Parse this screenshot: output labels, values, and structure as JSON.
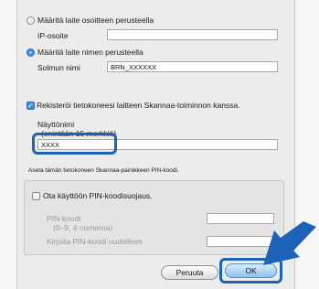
{
  "address_mode": {
    "ip_option_label": "Määritä laite osoitteen perusteella",
    "ip_field_label": "IP-osoite",
    "ip_field_value": "",
    "name_option_label": "Määritä laite nimen perusteella",
    "node_field_label": "Solmun nimi",
    "node_field_value": "BRN_XXXXXX"
  },
  "register": {
    "checkbox_label": "Rekisteröi tietokoneesi laitteen Skannaa-toiminnon kanssa.",
    "checked": true,
    "display_name_label_line1": "Näyttönimi",
    "display_name_label_line2": "(enintään 15 merkkiä)",
    "display_name_value": "XXXX"
  },
  "pin": {
    "section_title": "Aseta tämän tietokoneen Skannaa-painikkeen PIN-koodi.",
    "enable_label": "Ota käyttöön PIN-koodisuojaus.",
    "enabled": false,
    "pin_label_line1": "PIN-koodi",
    "pin_label_line2": "(0–9, 4 numeroa)",
    "pin_value": "",
    "repeat_label": "Kirjoita PIN-koodi uudelleen",
    "repeat_value": ""
  },
  "buttons": {
    "cancel_label": "Peruuta",
    "ok_label": "OK"
  },
  "colors": {
    "highlight": "#1c63b8",
    "arrow": "#1c63b8"
  },
  "icons": {
    "pointer": "arrow-icon"
  }
}
